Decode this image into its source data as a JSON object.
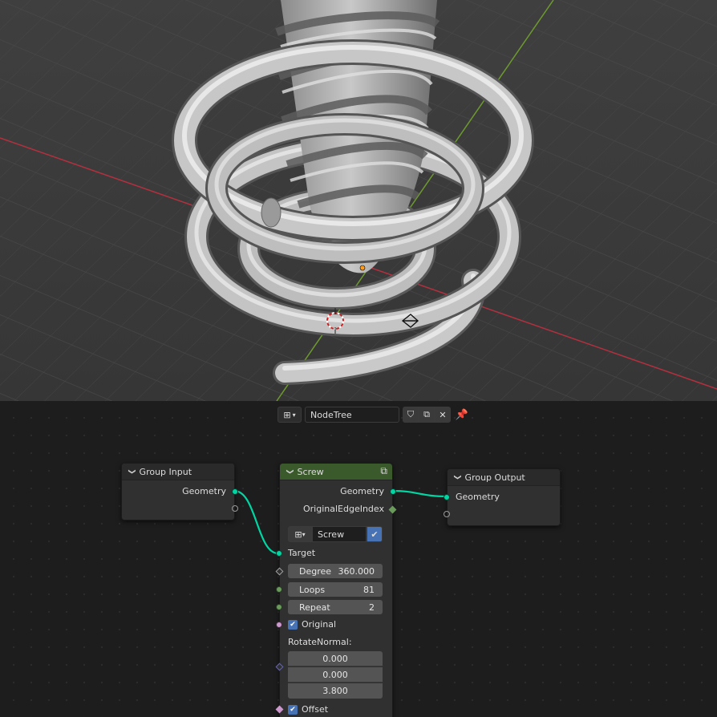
{
  "editor_header": {
    "tree_name": "NodeTree"
  },
  "nodes": {
    "group_input": {
      "title": "Group Input",
      "outputs": [
        "Geometry"
      ]
    },
    "screw": {
      "title": "Screw",
      "outputs": [
        "Geometry",
        "OriginalEdgeIndex"
      ],
      "datablock": "Screw",
      "target_label": "Target",
      "degree_label": "Degree",
      "degree_value": "360.000",
      "loops_label": "Loops",
      "loops_value": "81",
      "repeat_label": "Repeat",
      "repeat_value": "2",
      "original_label": "Original",
      "rotate_normal_label": "RotateNormal:",
      "rotate_normal": [
        "0.000",
        "0.000",
        "3.800"
      ],
      "offset_label": "Offset"
    },
    "group_output": {
      "title": "Group Output",
      "inputs": [
        "Geometry"
      ]
    }
  },
  "colors": {
    "geometry_socket": "#00d6a3",
    "screw_header": "#3b5a2c",
    "x_axis": "#b3303f",
    "y_axis": "#6d9a2d",
    "checkbox": "#4772b3"
  }
}
